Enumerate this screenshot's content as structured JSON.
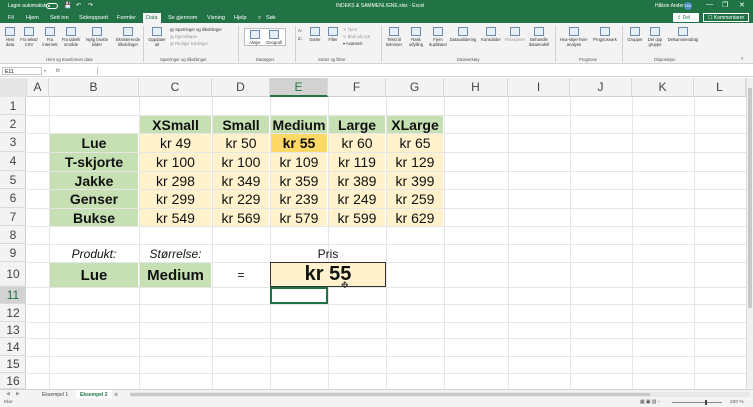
{
  "titlebar": {
    "autosave_label": "Lagre automatisk",
    "doc_title": "INDEKS & SAMMENLIGNE.xlsx  -  Excel",
    "user_name": "Håkon Andersen",
    "user_initials": "HA",
    "qa_save": "💾",
    "qa_undo": "↶",
    "qa_redo": "↷",
    "minimize": "—",
    "restore": "❐",
    "close": "✕"
  },
  "tabs": {
    "items": [
      "Fil",
      "Hjem",
      "Sett inn",
      "Sideoppsett",
      "Formler",
      "Data",
      "Se gjennom",
      "Visning",
      "Hjelp"
    ],
    "search_placeholder": "Søk",
    "share": "Del",
    "comments": "Kommentarer"
  },
  "ribbon": {
    "hent": [
      "Hent data",
      "Fra tekst/ CSV",
      "Fra internett",
      "Fra tabell/ område",
      "Nylig brukte kilder",
      "Eksisterende tilkoblinger"
    ],
    "oppdater": "Oppdater alt",
    "sporringer": [
      "Spørringer og tilkoblinger",
      "Egenskaper",
      "Rediger koblinger"
    ],
    "datatyper": [
      "Aksjer",
      "Geografi"
    ],
    "sortfilter": [
      "Sorter",
      "Filter",
      "Fjern",
      "Bruk på nytt",
      "Avansert"
    ],
    "verktoy": [
      "Tekst til kolonner",
      "Rask utfylling",
      "Fjern duplikater",
      "Datavalidering",
      "Konsolider",
      "Relasjoner",
      "Behandle datamodell"
    ],
    "prognose": [
      "Hva-skjer-hvis-analyse",
      "Prognoseark"
    ],
    "disposisjon": [
      "Grupper",
      "Del opp gruppe",
      "Delsammendrag"
    ],
    "groups": [
      "Hent og transformer data",
      "Spørringer og tilkoblinger",
      "Datatyper",
      "Sorter og filtrer",
      "Dataverktøy",
      "Prognose",
      "Disposisjon"
    ]
  },
  "formula_bar": {
    "name_box": "E11",
    "fx": "fx",
    "value": ""
  },
  "columns": [
    "A",
    "B",
    "C",
    "D",
    "E",
    "F",
    "G",
    "H",
    "I",
    "J",
    "K",
    "L"
  ],
  "rows": [
    "1",
    "2",
    "3",
    "4",
    "5",
    "6",
    "7",
    "8",
    "9",
    "10",
    "11",
    "12",
    "13",
    "14",
    "15",
    "16"
  ],
  "selected_cell": "E11",
  "table": {
    "size_headers": [
      "XSmall",
      "Small",
      "Medium",
      "Large",
      "XLarge"
    ],
    "rows": [
      {
        "product": "Lue",
        "prices": [
          "kr 49",
          "kr 50",
          "kr 55",
          "kr 60",
          "kr 65"
        ]
      },
      {
        "product": "T-skjorte",
        "prices": [
          "kr 100",
          "kr 100",
          "kr 109",
          "kr 119",
          "kr 129"
        ]
      },
      {
        "product": "Jakke",
        "prices": [
          "kr 298",
          "kr 349",
          "kr 359",
          "kr 389",
          "kr 399"
        ]
      },
      {
        "product": "Genser",
        "prices": [
          "kr 299",
          "kr 229",
          "kr 239",
          "kr 249",
          "kr 259"
        ]
      },
      {
        "product": "Bukse",
        "prices": [
          "kr 549",
          "kr 569",
          "kr 579",
          "kr 599",
          "kr 629"
        ]
      }
    ],
    "highlight": {
      "row": 0,
      "col": 2
    }
  },
  "lookup": {
    "product_label": "Produkt:",
    "size_label": "Størrelse:",
    "price_label": "Pris",
    "product_value": "Lue",
    "size_value": "Medium",
    "equals": "=",
    "result": "kr 55"
  },
  "colors": {
    "excel_green": "#217346",
    "header_green": "#c6e0b4",
    "value_yellow": "#fff2cc",
    "highlight_yellow": "#ffd966"
  },
  "sheets": {
    "tabs": [
      "Eksempel 1",
      "Eksempel 2"
    ],
    "active": "Eksempel 2",
    "add": "⊕"
  },
  "status": {
    "ready": "Klar",
    "zoom": "220 %"
  }
}
